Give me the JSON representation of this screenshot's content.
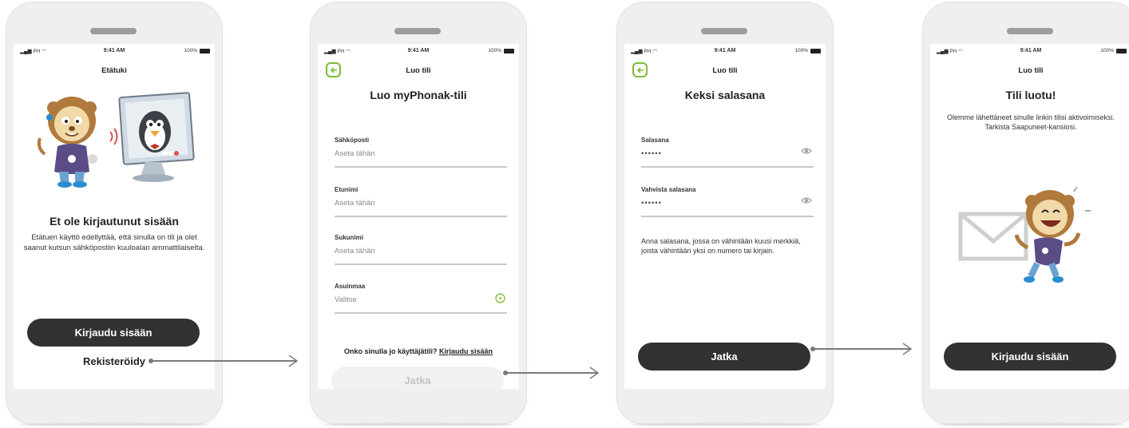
{
  "status_bar": {
    "signal": "PH",
    "time": "9:41 AM",
    "battery": "100%"
  },
  "screen1": {
    "nav_title": "Etätuki",
    "heading": "Et ole kirjautunut sisään",
    "body": "Etätuen käyttö edellyttää, että sinulla on tili ja olet saanut kutsun sähköpostiin kuulo­alan ammattilaiselta.",
    "signin_button": "Kirjaudu sisään",
    "register_link": "Rekisteröidy"
  },
  "screen2": {
    "nav_title": "Luo tili",
    "heading": "Luo myPhonak-tili",
    "fields": [
      {
        "label": "Sähköposti",
        "placeholder": "Aseta tähän"
      },
      {
        "label": "Etunimi",
        "placeholder": "Aseta tähän"
      },
      {
        "label": "Sukunimi",
        "placeholder": "Aseta tähän"
      },
      {
        "label": "Asuinmaa",
        "placeholder": "Valitse"
      }
    ],
    "account_question": "Onko sinulla jo käyttäjätili?",
    "signin_link": "Kirjaudu sisään",
    "continue_button": "Jatka"
  },
  "screen3": {
    "nav_title": "Luo tili",
    "heading": "Keksi salasana",
    "fields": [
      {
        "label": "Salasana",
        "value": "••••••"
      },
      {
        "label": "Vahvista salasana",
        "value": "••••••"
      }
    ],
    "hint": "Anna salasana, jossa on vähintään kuusi merkkiä, joista vähintään yksi on numero tai kirjain.",
    "continue_button": "Jatka"
  },
  "screen4": {
    "nav_title": "Luo tili",
    "heading": "Tili luotu!",
    "body": "Olemme lähettäneet sinulle linkin tilisi aktivoimiseksi. Tarkista Saapuneet-kansiosi.",
    "signin_button": "Kirjaudu sisään"
  },
  "colors": {
    "accent": "#7dbb34",
    "button_dark": "#323232",
    "phone_frame": "#efefef",
    "connector": "#7a7a7a"
  }
}
